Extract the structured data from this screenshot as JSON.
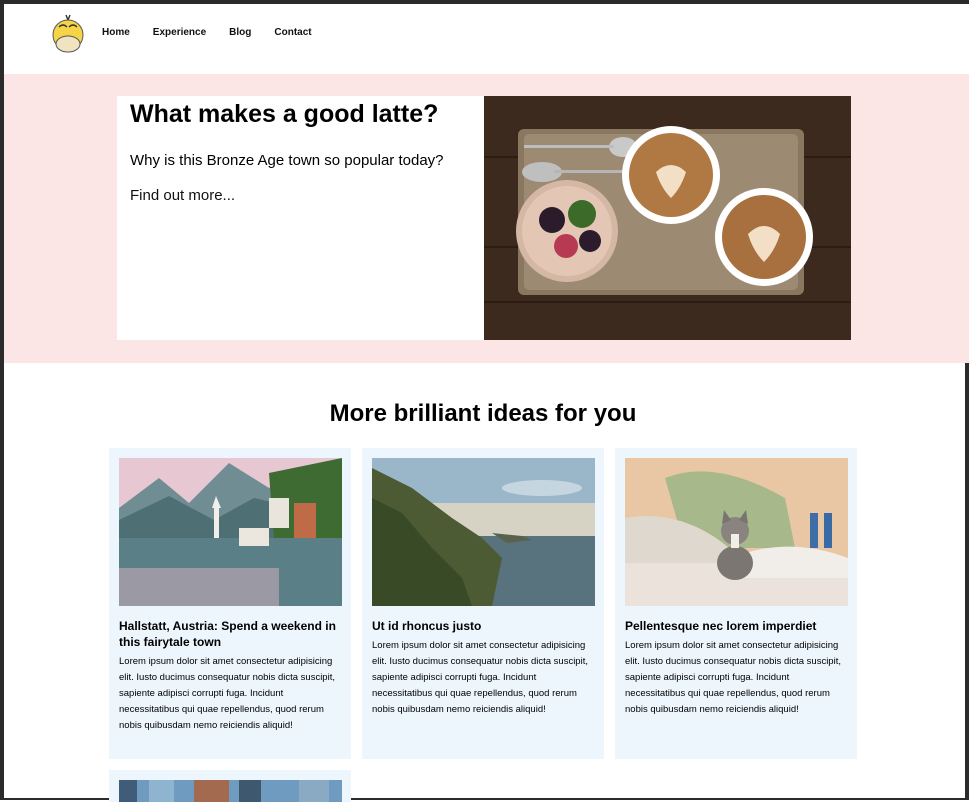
{
  "nav": {
    "links": [
      "Home",
      "Experience",
      "Blog",
      "Contact"
    ]
  },
  "hero": {
    "title": "What makes a good latte?",
    "subtitle": "Why is this Bronze Age town so popular today?",
    "link": "Find out more..."
  },
  "ideas": {
    "heading": "More brilliant ideas for you",
    "cards": [
      {
        "title": "Hallstatt, Austria: Spend a weekend in this fairytale town",
        "text": "Lorem ipsum dolor sit amet consectetur adipisicing elit. Iusto ducimus consequatur nobis dicta suscipit, sapiente adipisci corrupti fuga. Incidunt necessitatibus qui quae repellendus, quod rerum nobis quibusdam nemo reiciendis aliquid!"
      },
      {
        "title": "Ut id rhoncus justo",
        "text": "Lorem ipsum dolor sit amet consectetur adipisicing elit. Iusto ducimus consequatur nobis dicta suscipit, sapiente adipisci corrupti fuga. Incidunt necessitatibus qui quae repellendus, quod rerum nobis quibusdam nemo reiciendis aliquid!"
      },
      {
        "title": "Pellentesque nec lorem imperdiet",
        "text": "Lorem ipsum dolor sit amet consectetur adipisicing elit. Iusto ducimus consequatur nobis dicta suscipit, sapiente adipisci corrupti fuga. Incidunt necessitatibus qui quae repellendus, quod rerum nobis quibusdam nemo reiciendis aliquid!"
      }
    ]
  }
}
